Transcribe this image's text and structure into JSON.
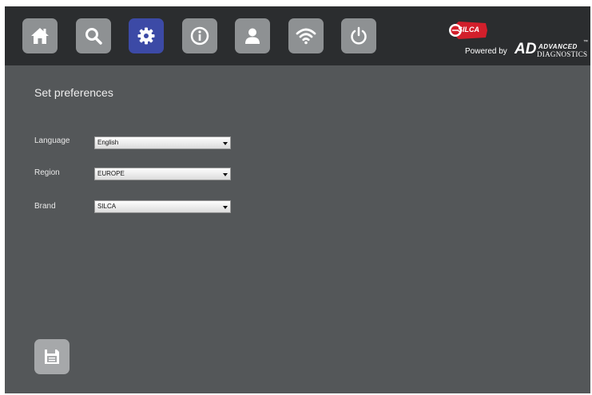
{
  "toolbar": {
    "buttons": [
      {
        "name": "home",
        "icon": "home-icon"
      },
      {
        "name": "search",
        "icon": "search-icon"
      },
      {
        "name": "settings",
        "icon": "gear-icon",
        "active": true
      },
      {
        "name": "info",
        "icon": "info-icon"
      },
      {
        "name": "user",
        "icon": "user-icon"
      },
      {
        "name": "wifi",
        "icon": "wifi-icon"
      },
      {
        "name": "power",
        "icon": "power-icon"
      }
    ],
    "colors": {
      "bar": "#2b2d2f",
      "button": "#8e9193",
      "active": "#3c4aa6"
    }
  },
  "brand": {
    "silca": "SILCA",
    "powered_by": "Powered by",
    "ad_mark": "AD",
    "advanced": "ADVANCED",
    "diagnostics": "DIAGNOSTICS",
    "tm": "™",
    "silca_color": "#d21f2b"
  },
  "page": {
    "title": "Set preferences",
    "background": "#545759"
  },
  "form": {
    "language": {
      "label": "Language",
      "value": "English"
    },
    "region": {
      "label": "Region",
      "value": "EUROPE"
    },
    "brand": {
      "label": "Brand",
      "value": "SILCA"
    }
  },
  "save": {
    "icon": "save-icon"
  }
}
